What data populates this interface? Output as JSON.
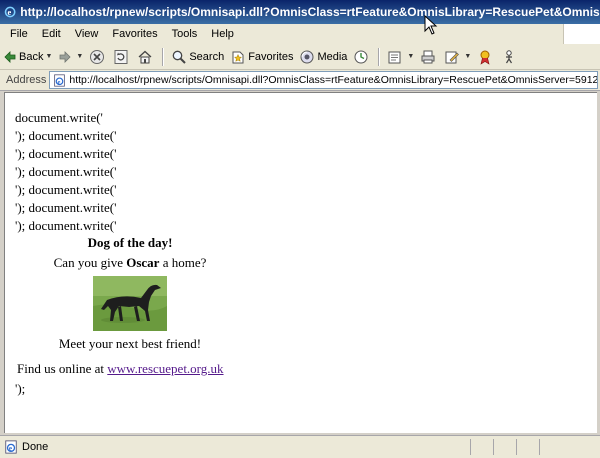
{
  "window": {
    "title": "http://localhost/rpnew/scripts/Omnisapi.dll?OmnisClass=rtFeature&OmnisLibrary=RescuePet&OmnisSe - Microsoft Internet Explorer"
  },
  "menu": {
    "items": [
      "File",
      "Edit",
      "View",
      "Favorites",
      "Tools",
      "Help"
    ]
  },
  "toolbar": {
    "back_label": "Back",
    "search_label": "Search",
    "favorites_label": "Favorites",
    "media_label": "Media"
  },
  "address": {
    "label": "Address",
    "url": "http://localhost/rpnew/scripts/Omnisapi.dll?OmnisClass=rtFeature&OmnisLibrary=RescuePet&OmnisServer=5912"
  },
  "page": {
    "code_lines": [
      "document.write('",
      "'); document.write('",
      "'); document.write('",
      "'); document.write('",
      "'); document.write('",
      "'); document.write('",
      "'); document.write('"
    ],
    "dog_title": "Dog of the day!",
    "give_prefix": "Can you give ",
    "dog_name": "Oscar",
    "give_suffix": " a home?",
    "meet_text": "Meet your next best friend!",
    "find_prefix": "Find us online at ",
    "link_text": "www.rescuepet.org.uk",
    "end_text": "');"
  },
  "status": {
    "text": "Done"
  }
}
